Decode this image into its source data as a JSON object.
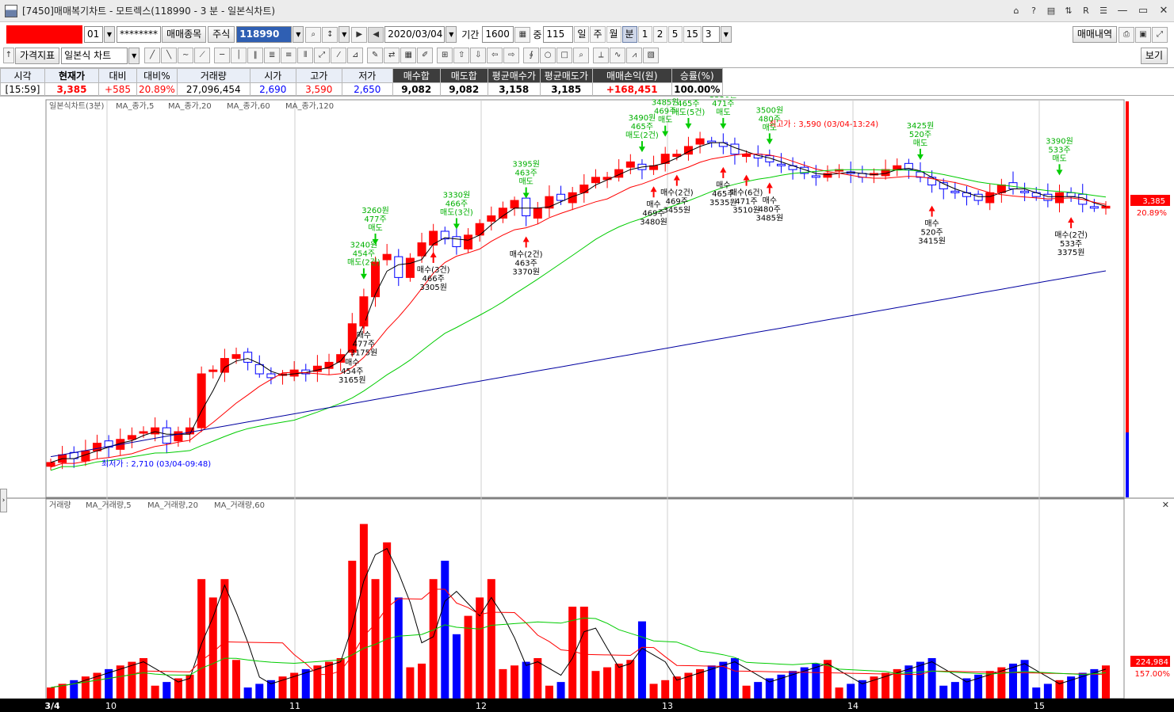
{
  "window": {
    "title": "[7450]매매복기차트 - 모트렉스(118990 - 3 분 - 일본식차트)",
    "toolbar_icons": [
      "pin-icon",
      "help-icon",
      "layout-icon",
      "sort-icon",
      "r-icon",
      "settings-icon"
    ],
    "help_glyph": "?",
    "r_glyph": "R"
  },
  "toolbar1": {
    "account_value": "",
    "account_suffix": "01",
    "password": "********",
    "stock_button": "매매종목",
    "market_label": "주식",
    "code_value": "118990",
    "date_value": "2020/03/04",
    "period_label": "기간",
    "period_value": "1600",
    "count_label": "중",
    "count_value": "115",
    "period_tabs": [
      "일",
      "주",
      "월",
      "분"
    ],
    "minute_tabs": [
      "1",
      "2",
      "5",
      "15"
    ],
    "minute_value": "3",
    "history_button": "매매내역"
  },
  "toolbar2": {
    "indicator_button": "가격지표",
    "chart_type_value": "일본식 차트",
    "view_button": "보기"
  },
  "quote": {
    "headers": [
      "시각",
      "현재가",
      "대비",
      "대비%",
      "거래량",
      "시가",
      "고가",
      "저가",
      "매수합",
      "매도합",
      "평균매수가",
      "평균매도가",
      "매매손익(원)",
      "승률(%)"
    ],
    "values": [
      "[15:59]",
      "3,385",
      "+585",
      "20.89%",
      "27,096,454",
      "2,690",
      "3,590",
      "2,650",
      "9,082",
      "9,082",
      "3,158",
      "3,185",
      "+168,451",
      "100.00%"
    ]
  },
  "chart_data": [
    {
      "type": "candlestick",
      "legend": [
        "일본식차트(3분)",
        "MA_종가,5",
        "MA_종가,20",
        "MA_종가,60",
        "MA_종가,120"
      ],
      "price_last": "3,385",
      "price_change_pct": "20.89%",
      "high_note": "최고가 : 3,590 (03/04-13:24)",
      "low_note": "최저가 : 2,710 (03/04-09:48)",
      "colors": {
        "up": "#ff0000",
        "down": "#0000ff",
        "ma5": "#000000",
        "ma20": "#ff0000",
        "ma60": "#00cc00",
        "ma120": "#0000a0"
      },
      "x_ticks": [
        "3/4",
        "10",
        "11",
        "12",
        "13",
        "14",
        "15"
      ],
      "close_series": [
        2720,
        2740,
        2730,
        2750,
        2770,
        2760,
        2780,
        2790,
        2800,
        2810,
        2770,
        2800,
        2810,
        2950,
        2960,
        2990,
        3000,
        2980,
        2950,
        2940,
        2950,
        2960,
        2950,
        2970,
        2980,
        3000,
        3080,
        3150,
        3240,
        3260,
        3200,
        3250,
        3290,
        3320,
        3300,
        3280,
        3310,
        3340,
        3360,
        3380,
        3400,
        3360,
        3380,
        3410,
        3400,
        3420,
        3440,
        3460,
        3460,
        3480,
        3500,
        3480,
        3490,
        3520,
        3520,
        3540,
        3560,
        3550,
        3540,
        3520,
        3520,
        3510,
        3500,
        3490,
        3480,
        3470,
        3460,
        3470,
        3480,
        3470,
        3460,
        3470,
        3480,
        3490,
        3480,
        3460,
        3440,
        3430,
        3420,
        3410,
        3400,
        3420,
        3440,
        3430,
        3420,
        3410,
        3400,
        3420,
        3410,
        3390,
        3380,
        3385
      ],
      "buy_markers": [
        {
          "label": "매수",
          "qty": "454주",
          "price": "3165원"
        },
        {
          "label": "매수",
          "qty": "477주",
          "price": "3175원"
        },
        {
          "label": "매수(3건)",
          "qty": "466주",
          "price": "3305원"
        },
        {
          "label": "매수(2건)",
          "qty": "463주",
          "price": "3370원"
        },
        {
          "label": "매수",
          "qty": "469주",
          "price": "3480원"
        },
        {
          "label": "매수(2건)",
          "qty": "469주",
          "price": "3455원"
        },
        {
          "label": "매수",
          "qty": "465주",
          "price": "3535원"
        },
        {
          "label": "매수(6건)",
          "qty": "471주",
          "price": "3510원"
        },
        {
          "label": "매수",
          "qty": "480주",
          "price": "3485원"
        },
        {
          "label": "매수",
          "qty": "520주",
          "price": "3415원"
        },
        {
          "label": "매수(2건)",
          "qty": "533주",
          "price": "3375원"
        }
      ],
      "sell_markers": [
        {
          "label": "매도(2건)",
          "qty": "454주",
          "price": "3240원"
        },
        {
          "label": "매도",
          "qty": "477주",
          "price": "3260원"
        },
        {
          "label": "매도(3건)",
          "qty": "466주",
          "price": "3330원"
        },
        {
          "label": "매도",
          "qty": "463주",
          "price": "3395원"
        },
        {
          "label": "매도(2건)",
          "qty": "465주",
          "price": "3490원"
        },
        {
          "label": "매도",
          "qty": "469주",
          "price": "3485원"
        },
        {
          "label": "매도(5건)",
          "qty": "465주",
          "price": ""
        },
        {
          "label": "매도",
          "qty": "471주",
          "price": "3530원"
        },
        {
          "label": "매도",
          "qty": "480주",
          "price": "3500원"
        },
        {
          "label": "매도",
          "qty": "520주",
          "price": "3425원"
        },
        {
          "label": "매도",
          "qty": "533주",
          "price": "3390원"
        }
      ]
    },
    {
      "type": "bar",
      "legend": [
        "거래량",
        "MA_거래량,5",
        "MA_거래량,20",
        "MA_거래량,60"
      ],
      "volume_last": "224,984",
      "volume_change_pct": "157.00%",
      "colors": {
        "up": "#ff0000",
        "down": "#0000ff",
        "ma5": "#000000",
        "ma20": "#ff0000",
        "ma60": "#00cc00"
      }
    }
  ]
}
